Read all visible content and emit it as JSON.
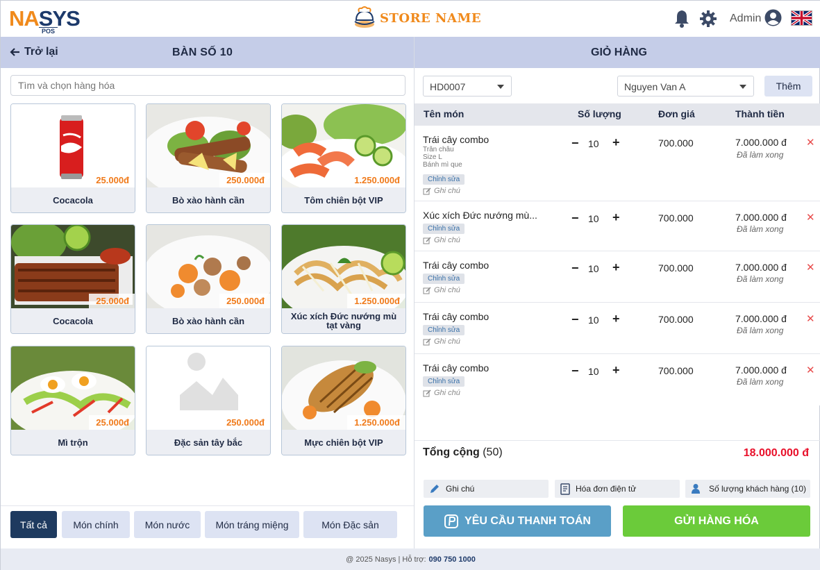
{
  "header": {
    "logo": {
      "part1": "NA",
      "part2": "SYS",
      "sub": "POS"
    },
    "store_name": "STORE NAME",
    "user_label": "Admin",
    "icons": [
      "bell-icon",
      "gear-icon",
      "user-circle-icon",
      "uk-flag-icon"
    ]
  },
  "left": {
    "back_label": "Trở lại",
    "table_title": "BÀN SỐ 10",
    "search_placeholder": "Tìm và chọn hàng hóa",
    "products": [
      {
        "name": "Cocacola",
        "price": "25.000đ"
      },
      {
        "name": "Bò xào hành cần",
        "price": "250.000đ"
      },
      {
        "name": "Tôm chiên bột VIP",
        "price": "1.250.000đ"
      },
      {
        "name": "Cocacola",
        "price": "25.000đ"
      },
      {
        "name": "Bò xào hành cần",
        "price": "250.000đ"
      },
      {
        "name": "Xúc xích Đức nướng mù tạt vàng",
        "price": "1.250.000đ"
      },
      {
        "name": "Mì trộn",
        "price": "25.000đ"
      },
      {
        "name": "Đặc sản tây bắc",
        "price": "250.000đ"
      },
      {
        "name": "Mực chiên bột VIP",
        "price": "1.250.000đ"
      }
    ],
    "categories": [
      "Tất cả",
      "Món chính",
      "Món nước",
      "Món tráng miệng",
      "Món Đặc sản"
    ],
    "active_category": "Tất cả"
  },
  "cart": {
    "title": "GIỎ HÀNG",
    "invoice_id": "HD0007",
    "customer": "Nguyen Van A",
    "add_label": "Thêm",
    "columns": [
      "Tên món",
      "Số lượng",
      "Đơn giá",
      "Thành tiền"
    ],
    "items": [
      {
        "name": "Trái cây combo",
        "options": [
          "Trân châu",
          "Size L",
          "Bánh mì que"
        ],
        "edit_label": "Chỉnh sửa",
        "note_label": "Ghi chú",
        "qty": "10",
        "unit_price": "700.000",
        "total": "7.000.000 đ",
        "status": "Đã làm xong"
      },
      {
        "name": "Xúc xích Đức nướng mù...",
        "options": [],
        "edit_label": "Chỉnh sửa",
        "note_label": "Ghi chú",
        "qty": "10",
        "unit_price": "700.000",
        "total": "7.000.000 đ",
        "status": "Đã làm xong"
      },
      {
        "name": "Trái cây combo",
        "options": [],
        "edit_label": "Chỉnh sửa",
        "note_label": "Ghi chú",
        "qty": "10",
        "unit_price": "700.000",
        "total": "7.000.000 đ",
        "status": "Đã làm xong"
      },
      {
        "name": "Trái cây combo",
        "options": [],
        "edit_label": "Chỉnh sửa",
        "note_label": "Ghi chú",
        "qty": "10",
        "unit_price": "700.000",
        "total": "7.000.000 đ",
        "status": "Đã làm xong"
      },
      {
        "name": "Trái cây combo",
        "options": [],
        "edit_label": "Chỉnh sửa",
        "note_label": "Ghi chú",
        "qty": "10",
        "unit_price": "700.000",
        "total": "7.000.000 đ",
        "status": "Đã làm xong"
      }
    ],
    "total_label": "Tổng cộng",
    "total_count": "(50)",
    "total_amount": "18.000.000 đ",
    "actions": {
      "note": "Ghi chú",
      "einvoice": "Hóa đơn điện tử",
      "guests": "Số lượng khách hàng (10)"
    },
    "pay_button": "YÊU CẦU THANH TOÁN",
    "send_button": "GỬI HÀNG HÓA"
  },
  "footer": {
    "copyright": "@ 2025 Nasys  | Hỗ trợ:",
    "phone": "090 750 1000"
  },
  "colors": {
    "accent_orange": "#f08a1c",
    "navy": "#1e3a5f",
    "header_bar": "#c5cde8",
    "pay_blue": "#5a9fc7",
    "send_green": "#6bcb3a",
    "total_red": "#e8102a",
    "delete_red": "#e84c4c"
  }
}
